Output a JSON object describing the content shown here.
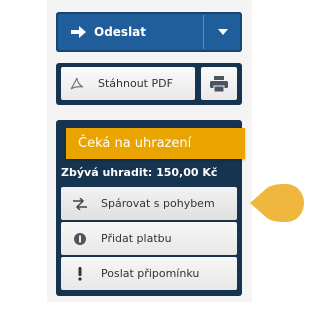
{
  "send": {
    "label": "Odeslat",
    "icon": "arrow-right-icon",
    "dropdown_icon": "caret-down-icon"
  },
  "pdf": {
    "label": "Stáhnout PDF",
    "icon": "pdf-icon",
    "print_icon": "printer-icon"
  },
  "status": {
    "label": "Čeká na uhrazení",
    "remaining": "Zbývá uhradit: 150,00 Kč",
    "actions": [
      {
        "label": "Spárovat s pohybem",
        "icon": "pair-arrows-icon"
      },
      {
        "label": "Přidat platbu",
        "icon": "payment-icon"
      },
      {
        "label": "Poslat připomínku",
        "icon": "exclamation-icon"
      }
    ]
  },
  "colors": {
    "primary": "#1f5e9a",
    "panel": "#16334f",
    "status": "#e9a400",
    "badge": "#efb73e"
  }
}
